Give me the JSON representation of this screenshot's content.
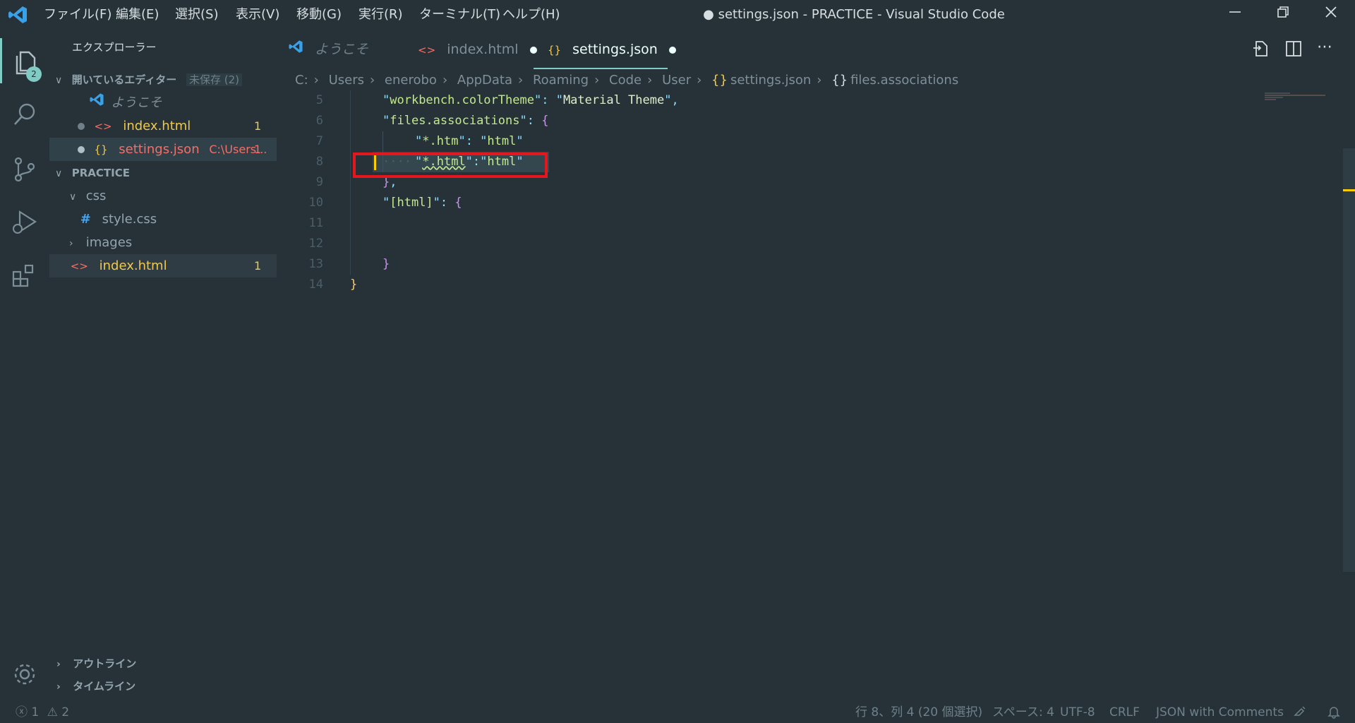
{
  "window": {
    "title": "● settings.json - PRACTICE - Visual Studio Code",
    "menus": [
      "ファイル(F)",
      "編集(E)",
      "選択(S)",
      "表示(V)",
      "移動(G)",
      "実行(R)",
      "ターミナル(T)",
      "ヘルプ(H)"
    ]
  },
  "activity": {
    "badge": "2"
  },
  "sidebar": {
    "title": "エクスプローラー",
    "open_editors": {
      "label": "開いているエディター",
      "unsaved": "未保存 (2)",
      "items": [
        {
          "name": "ようこそ",
          "path": "",
          "count": ""
        },
        {
          "name": "index.html",
          "path": "",
          "count": "1"
        },
        {
          "name": "settings.json",
          "path": "C:\\Users...",
          "count": "1"
        }
      ]
    },
    "project": {
      "label": "PRACTICE",
      "tree": [
        {
          "name": "css",
          "count": ""
        },
        {
          "name": "style.css",
          "count": ""
        },
        {
          "name": "images",
          "count": ""
        },
        {
          "name": "index.html",
          "count": "1"
        }
      ]
    },
    "outline": "アウトライン",
    "timeline": "タイムライン"
  },
  "tabs": [
    {
      "label": "ようこそ"
    },
    {
      "label": "index.html"
    },
    {
      "label": "settings.json"
    }
  ],
  "breadcrumb": [
    "C:",
    "Users",
    "enerobo",
    "AppData",
    "Roaming",
    "Code",
    "User",
    "settings.json",
    "files.associations"
  ],
  "editor": {
    "line_numbers": [
      "5",
      "6",
      "7",
      "8",
      "9",
      "10",
      "11",
      "12",
      "13",
      "14"
    ],
    "lines": {
      "l5_key": "workbench.colorTheme",
      "l5_val": "Material Theme",
      "l6_key": "files.associations",
      "l7_key": "*.htm",
      "l7_val": "html",
      "l8_key": "*.html",
      "l8_val": "html",
      "l10_key": "[html]"
    }
  },
  "status": {
    "errors": "1",
    "warnings": "2",
    "position": "行 8、列 4 (20 個選択)",
    "spaces": "スペース: 4",
    "encoding": "UTF-8",
    "eol": "CRLF",
    "language": "JSON with Comments"
  },
  "colors": {
    "accent": "#80cbc4",
    "highlight_box": "#e5161d",
    "background": "#263238"
  }
}
